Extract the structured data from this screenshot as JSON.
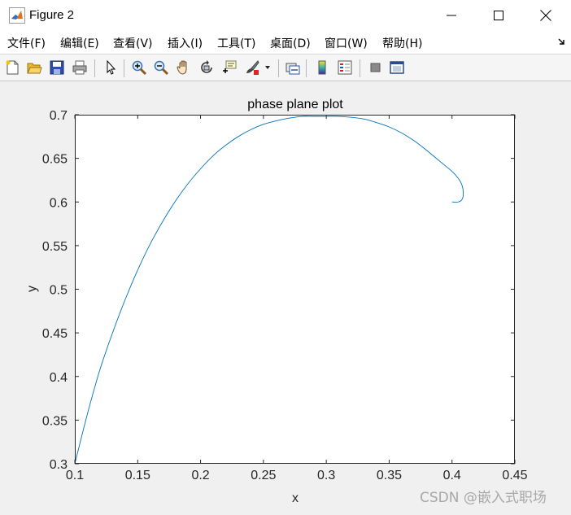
{
  "window": {
    "title": "Figure 2",
    "icons": [
      "matlab-logo-icon",
      "minimize-icon",
      "maximize-icon",
      "close-icon"
    ]
  },
  "menu": {
    "items": [
      "文件(F)",
      "编辑(E)",
      "查看(V)",
      "插入(I)",
      "工具(T)",
      "桌面(D)",
      "窗口(W)",
      "帮助(H)"
    ],
    "overflow_icon": "dock-arrow-icon"
  },
  "toolbar": {
    "icons": [
      "new-figure-icon",
      "open-file-icon",
      "save-icon",
      "print-icon",
      "edit-plot-cursor-icon",
      "zoom-in-icon",
      "zoom-out-icon",
      "pan-hand-icon",
      "rotate-3d-icon",
      "data-cursor-icon",
      "brush-icon",
      "brush-dropdown-icon",
      "link-plot-icon",
      "colorbar-icon",
      "legend-icon",
      "hide-plot-tools-icon",
      "show-plot-tools-icon"
    ]
  },
  "colors": {
    "line": "#0072bd",
    "axes_bg": "#ffffff",
    "figure_bg": "#f0f0f0"
  },
  "chart_data": {
    "type": "line",
    "title": "phase plane plot",
    "xlabel": "x",
    "ylabel": "y",
    "xlim": [
      0.1,
      0.45
    ],
    "ylim": [
      0.3,
      0.7
    ],
    "xticks": [
      0.1,
      0.15,
      0.2,
      0.25,
      0.3,
      0.35,
      0.4,
      0.45
    ],
    "yticks": [
      0.3,
      0.35,
      0.4,
      0.45,
      0.5,
      0.55,
      0.6,
      0.65,
      0.7
    ],
    "xtick_labels": [
      "0.1",
      "0.15",
      "0.2",
      "0.25",
      "0.3",
      "0.35",
      "0.4",
      "0.45"
    ],
    "ytick_labels": [
      "0.3",
      "0.35",
      "0.4",
      "0.45",
      "0.5",
      "0.55",
      "0.6",
      "0.65",
      "0.7"
    ],
    "grid": false,
    "series": [
      {
        "x": [
          0.1,
          0.11,
          0.12,
          0.13,
          0.14,
          0.15,
          0.16,
          0.17,
          0.18,
          0.19,
          0.2,
          0.21,
          0.22,
          0.23,
          0.24,
          0.25,
          0.26,
          0.27,
          0.28,
          0.29,
          0.3,
          0.31,
          0.32,
          0.33,
          0.34,
          0.35,
          0.36,
          0.37,
          0.38,
          0.39,
          0.4,
          0.405,
          0.408,
          0.409,
          0.408,
          0.405,
          0.4
        ],
        "y": [
          0.3,
          0.357,
          0.408,
          0.45,
          0.488,
          0.522,
          0.552,
          0.578,
          0.601,
          0.621,
          0.638,
          0.653,
          0.665,
          0.675,
          0.683,
          0.689,
          0.693,
          0.696,
          0.698,
          0.698,
          0.698,
          0.698,
          0.697,
          0.695,
          0.691,
          0.686,
          0.679,
          0.67,
          0.659,
          0.647,
          0.635,
          0.627,
          0.619,
          0.61,
          0.603,
          0.6,
          0.6
        ]
      }
    ]
  },
  "watermark": "CSDN @嵌入式职场"
}
